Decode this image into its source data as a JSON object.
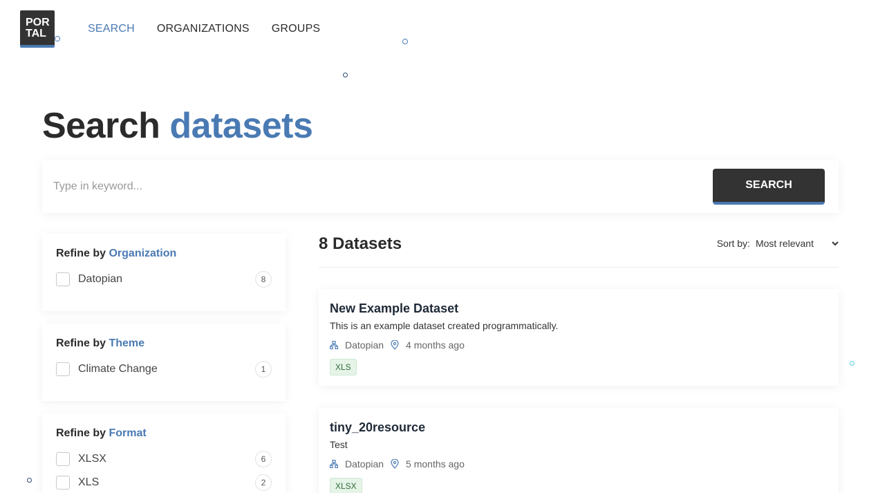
{
  "header": {
    "logo_line1": "POR",
    "logo_line2": "TAL",
    "nav": [
      {
        "label": "SEARCH",
        "active": true
      },
      {
        "label": "ORGANIZATIONS",
        "active": false
      },
      {
        "label": "GROUPS",
        "active": false
      }
    ]
  },
  "title": {
    "part1": "Search",
    "part2": "datasets"
  },
  "search": {
    "placeholder": "Type in keyword...",
    "button_label": "SEARCH"
  },
  "facets": [
    {
      "prefix": "Refine by",
      "name": "Organization",
      "items": [
        {
          "label": "Datopian",
          "count": "8"
        }
      ]
    },
    {
      "prefix": "Refine by",
      "name": "Theme",
      "items": [
        {
          "label": "Climate Change",
          "count": "1"
        }
      ]
    },
    {
      "prefix": "Refine by",
      "name": "Format",
      "items": [
        {
          "label": "XLSX",
          "count": "6"
        },
        {
          "label": "XLS",
          "count": "2"
        }
      ]
    }
  ],
  "results": {
    "count_label": "8 Datasets",
    "sort_label": "Sort by:",
    "sort_value": "Most relevant"
  },
  "datasets": [
    {
      "title": "New Example Dataset",
      "description": "This is an example dataset created programmatically.",
      "organization": "Datopian",
      "modified": "4 months ago",
      "format": "XLS"
    },
    {
      "title": "tiny_20resource",
      "description": "Test",
      "organization": "Datopian",
      "modified": "5 months ago",
      "format": "XLSX"
    }
  ],
  "colors": {
    "accent": "#4a7ab3",
    "dark": "#333333",
    "tag_bg": "#e6f4e8"
  }
}
